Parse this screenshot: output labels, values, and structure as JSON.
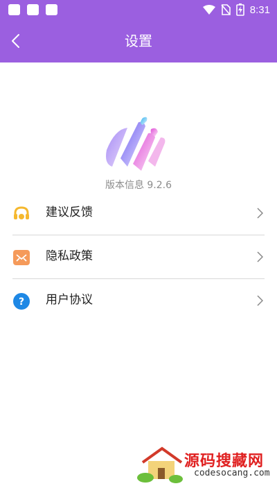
{
  "status_bar": {
    "time": "8:31",
    "icons": [
      "notification-square-icon",
      "notification-square-icon",
      "notification-square-icon",
      "wifi-icon",
      "no-sim-icon",
      "battery-charging-icon"
    ]
  },
  "header": {
    "title": "设置",
    "background": "#9b5fe0",
    "back_icon": "chevron-left-icon"
  },
  "app_info": {
    "version_text": "版本信息 9.2.6"
  },
  "menu": {
    "items": [
      {
        "label": "建议反馈",
        "icon": "headset-icon",
        "icon_color": "#f5b82e"
      },
      {
        "label": "隐私政策",
        "icon": "envelope-icon",
        "icon_color": "#f59a5a"
      },
      {
        "label": "用户协议",
        "icon": "question-circle-icon",
        "icon_color": "#1e88e5"
      }
    ],
    "chevron_icon": "chevron-right-icon"
  },
  "watermark": {
    "title": "源码搜藏网",
    "url": "codesocang.com"
  }
}
